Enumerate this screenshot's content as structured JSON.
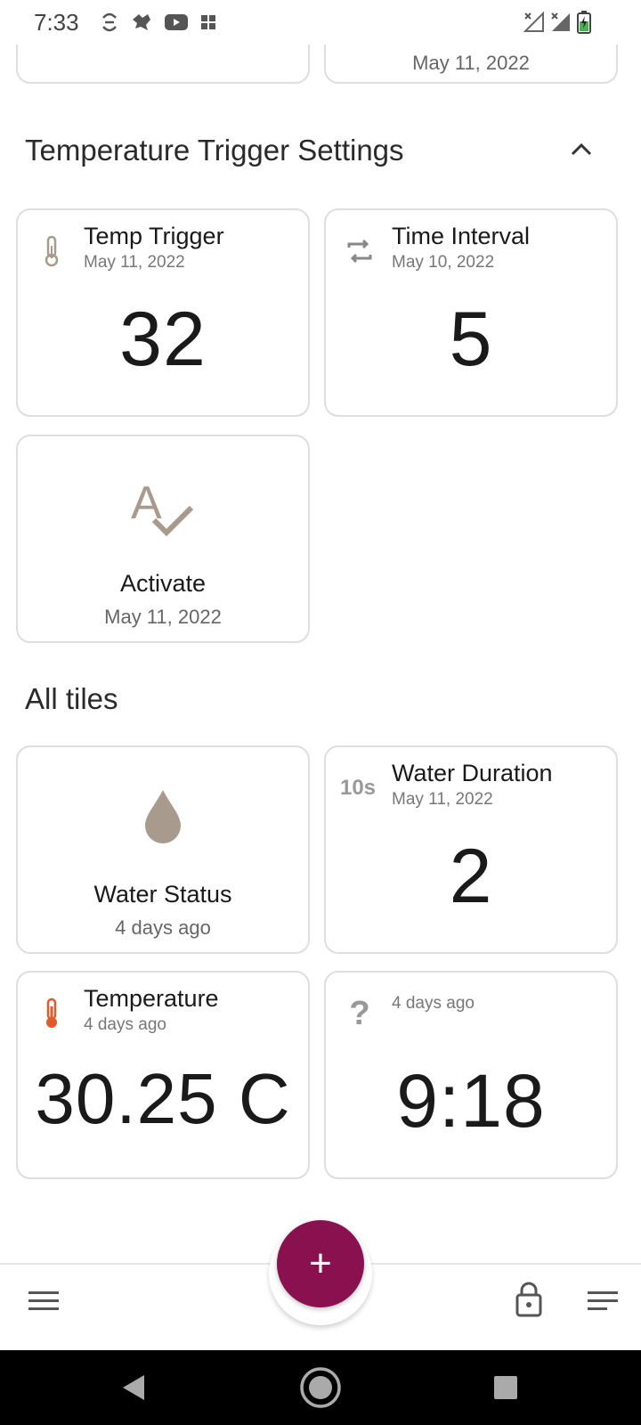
{
  "status_bar": {
    "time": "7:33",
    "icons": [
      "sync-icon",
      "bird-icon",
      "youtube-icon",
      "grid-icon"
    ],
    "right_icons": [
      "signal-x-icon",
      "signal-x-icon",
      "battery-charging-icon"
    ]
  },
  "top_tiles": {
    "right_date": "May 11, 2022"
  },
  "section_temp": {
    "title": "Temperature Trigger Settings",
    "tiles": [
      {
        "title": "Temp Trigger",
        "date": "May 11, 2022",
        "value": "32",
        "icon": "thermometer-icon"
      },
      {
        "title": "Time Interval",
        "date": "May 10, 2022",
        "value": "5",
        "icon": "repeat-icon"
      },
      {
        "title": "Activate",
        "date": "May 11, 2022",
        "icon": "spellcheck-icon"
      }
    ]
  },
  "section_all": {
    "title": "All tiles",
    "tiles": [
      {
        "title": "Water Status",
        "date": "4 days ago",
        "icon": "water-drop-icon"
      },
      {
        "title": "Water Duration",
        "date": "May 11, 2022",
        "value": "2",
        "icon_text": "10s"
      },
      {
        "title": "Temperature",
        "date": "4 days ago",
        "value": "30.25 C",
        "icon": "thermometer-icon"
      },
      {
        "title": "",
        "date": "4 days ago",
        "value": "9:18",
        "icon_text": "?"
      }
    ]
  },
  "bottom_bar": {
    "fab_label": "+",
    "icons": [
      "menu-icon",
      "lock-icon",
      "sort-icon"
    ]
  },
  "nav_bar": {
    "icons": [
      "back-icon",
      "home-icon",
      "recents-icon"
    ]
  },
  "colors": {
    "accent": "#8a1150",
    "icon_gray": "#a89a8c",
    "thermo_red": "#e05a2b"
  }
}
